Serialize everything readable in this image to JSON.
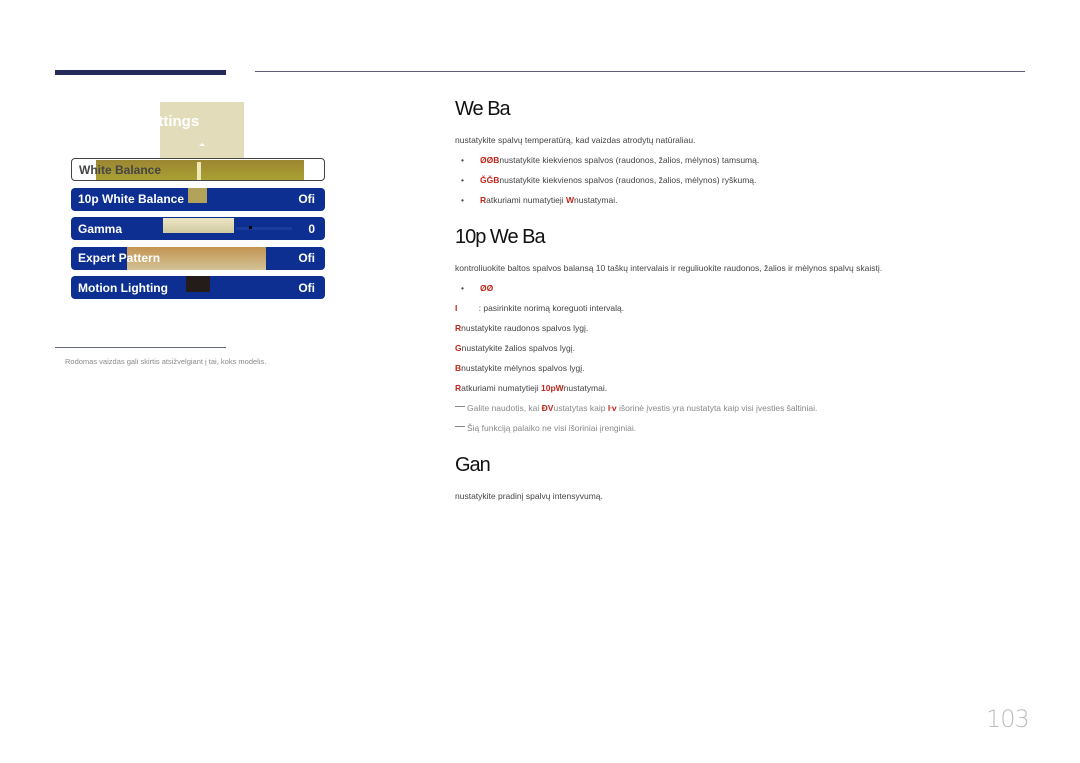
{
  "osd": {
    "title": "ettings",
    "rows": [
      {
        "label": "White Balance",
        "value": ""
      },
      {
        "label": "10p White Balance",
        "value": "Ofi"
      },
      {
        "label": "Gamma",
        "value": "0"
      },
      {
        "label": "Expert Pattern",
        "value": "Ofi"
      },
      {
        "label": "Motion Lighting",
        "value": "Ofi"
      }
    ]
  },
  "footnote": "Rodomas vaizdas gali skirtis atsižvelgiant į tai, koks modelis.",
  "sections": {
    "wb": {
      "heading": "We    Ba",
      "intro": "nustatykite spalvų temperatūrą, kad vaizdas atrodytų natūraliau.",
      "bullets": [
        {
          "key": "ØØB",
          "text": "nustatykite kiekvienos spalvos (raudonos, žalios, mėlynos) tamsumą."
        },
        {
          "key": "ĞĞB",
          "text": "nustatykite kiekvienos spalvos (raudonos, žalios, mėlynos) ryškumą."
        },
        {
          "key": "R",
          "text": "atkuriami numatytieji ",
          "key2": "W",
          "text2": "nustatymai."
        }
      ]
    },
    "p10": {
      "heading": "10p We    Ba",
      "intro": "kontroliuokite baltos spalvos balansą 10 taškų intervalais ir reguliuokite raudonos, žalios ir mėlynos spalvų skaistį.",
      "bullet_key": "ØØ",
      "lines": [
        {
          "key": "I",
          "text": "         : pasirinkite norimą koreguoti intervalą."
        },
        {
          "key": "R",
          "text": "nustatykite raudonos spalvos lygį."
        },
        {
          "key": "G",
          "text": "nustatykite žalios spalvos lygį."
        },
        {
          "key": "B",
          "text": "nustatykite mėlynos spalvos lygį."
        },
        {
          "key": "R",
          "text": "atkuriami numatytieji ",
          "key2": "10pW",
          "text2": "nustatymai."
        }
      ],
      "notes": [
        {
          "pre": "Galite naudotis, kai ",
          "key": "ĐV",
          "mid": "ustatytas kaip ",
          "key2": "ŀv",
          "post": " išorinė įvestis yra nustatyta kaip visi įvesties šaltiniai."
        },
        {
          "pre": "Šią funkciją palaiko ne visi išoriniai įrenginiai."
        }
      ]
    },
    "gamma": {
      "heading": "Gan",
      "intro": "nustatykite pradinį spalvų intensyvumą."
    }
  },
  "page_number": "103"
}
